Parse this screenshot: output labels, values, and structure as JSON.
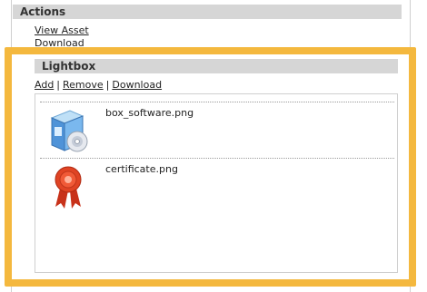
{
  "actions": {
    "title": "Actions",
    "view_asset": "View Asset",
    "download": "Download"
  },
  "lightbox": {
    "title": "Lightbox",
    "links": {
      "add": "Add",
      "sep1": "|",
      "remove": "Remove",
      "sep2": "|",
      "download": "Download"
    },
    "items": [
      {
        "filename": "box_software.png",
        "icon": "software-box-icon"
      },
      {
        "filename": "certificate.png",
        "icon": "certificate-ribbon-icon"
      }
    ]
  },
  "colors": {
    "highlight": "#f4b83e",
    "header_bg": "#d6d6d6",
    "ribbon_red": "#d8391c"
  }
}
